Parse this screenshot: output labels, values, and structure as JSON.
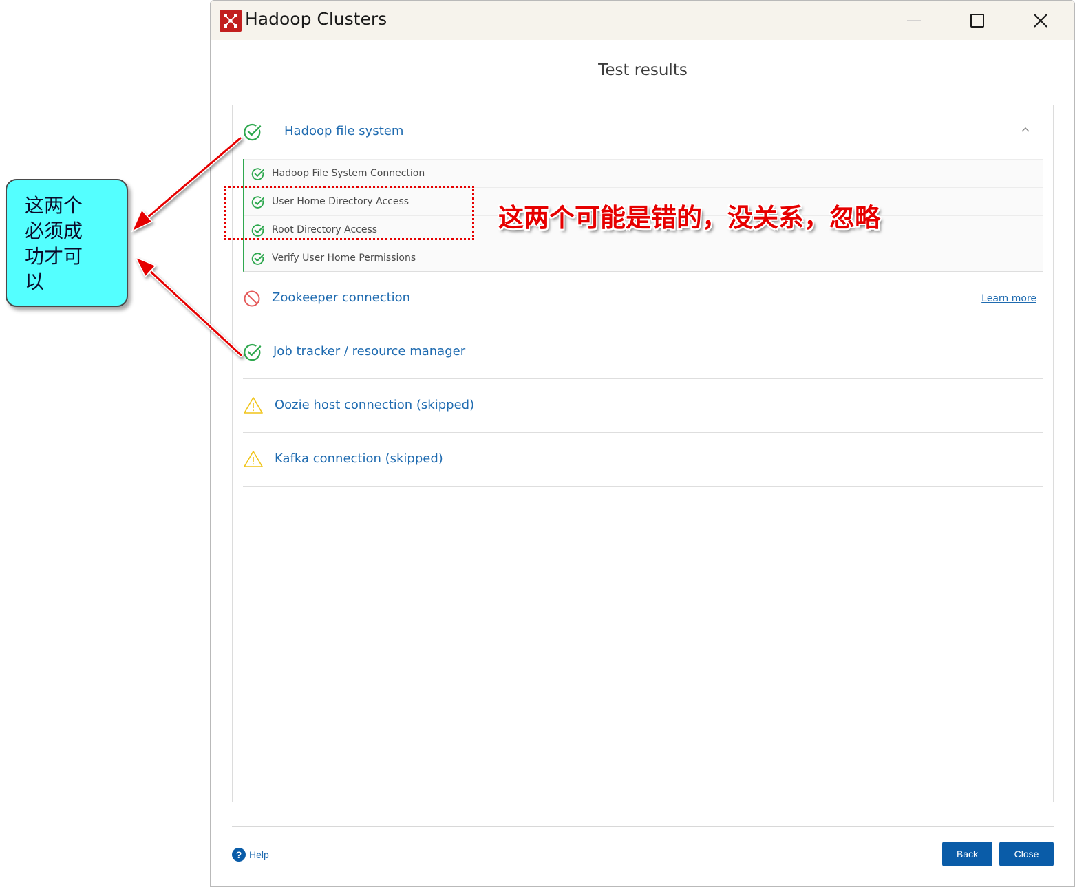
{
  "window": {
    "title": "Hadoop Clusters"
  },
  "page": {
    "title": "Test results"
  },
  "sections": {
    "hdfs": {
      "label": "Hadoop file system",
      "status": "success",
      "expanded": true,
      "sub_items": [
        {
          "label": "Hadoop File System Connection",
          "status": "success"
        },
        {
          "label": "User Home Directory Access",
          "status": "success"
        },
        {
          "label": "Root Directory Access",
          "status": "success"
        },
        {
          "label": "Verify User Home Permissions",
          "status": "success"
        }
      ]
    },
    "zookeeper": {
      "label": "Zookeeper connection",
      "status": "error",
      "learn_more": "Learn more"
    },
    "jobtracker": {
      "label": "Job tracker / resource manager",
      "status": "success"
    },
    "oozie": {
      "label": "Oozie host connection (skipped)",
      "status": "skipped"
    },
    "kafka": {
      "label": "Kafka connection (skipped)",
      "status": "skipped"
    }
  },
  "footer": {
    "help_label": "Help",
    "back_label": "Back",
    "close_label": "Close"
  },
  "annotations": {
    "callout_text": "这两个\n必须成\n功才可\n以",
    "note_text": "这两个可能是错的，没关系，忽略"
  },
  "colors": {
    "success": "#2fa84f",
    "error": "#e45a5a",
    "warning": "#f0c419",
    "link": "#1f6bb0",
    "primary_button": "#0a5ca8",
    "annotation_red": "#e60000",
    "callout_bg": "#54ffff"
  }
}
